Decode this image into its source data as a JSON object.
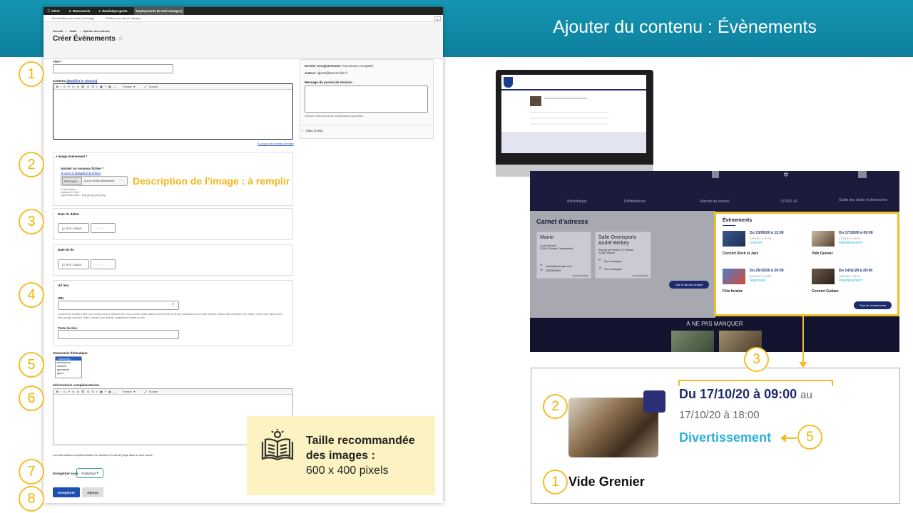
{
  "slide": {
    "title": "Ajouter du contenu : Évènements"
  },
  "toolbar": {
    "gerer": "Gérer",
    "raccourcis": "Raccourcis",
    "user": "dominique grota",
    "deploy": "Deployments (9 total changes)"
  },
  "subbar": {
    "preview": "Prévisualiser mon site (9 change)",
    "publish": "Publier mon site (9 change)"
  },
  "breadcrumb": [
    "Accueil",
    "Node",
    "Ajouter du contenu"
  ],
  "page_title": "Créer Événements",
  "form": {
    "titre_label": "Titre *",
    "contenu_label": "Contenu",
    "contenu_link": "(Modifier le résumé)",
    "format_label": "Format",
    "source_label": "Source",
    "formats_link": "À propos des formats de texte",
    "image_section": "Image événement *",
    "image_add": "Ajouter un nouveau fichier *",
    "image_browser": "Ouvrir le Navigateur de fichiers",
    "browse_button": "Parcourir...",
    "no_file": "Aucun fichier sélectionné.",
    "file_info": [
      "1 seul fichier.",
      "Limite à 10 Mo.",
      "Types autorisés : png gif jpg jpeg svg."
    ],
    "date_debut_label": "Date de début",
    "date_fin_label": "Date de fin",
    "date_placeholder": "jj / mm / aaaa",
    "time_placeholder": "--:--:--",
    "url_lieu_label": "Url lieu",
    "url_label": "URL",
    "url_help": "Commencer à saisir le titre d'un contenu pour le sélectionner. Vous pouvez aussi saisir le chemin interne tel que /node/add ou une URL externe comme http://example.com. Saisir <front> pour faire un lien vers la page d'accueil. Saisir <nolink> pour afficher uniquement le texte du lien.",
    "link_text_label": "Texte du lien",
    "taxonomy_label": "Taxonomie thématique",
    "taxonomy_options": [
      "- Aucun(e) -",
      "ceremonie",
      "concert",
      "spectacle",
      "sport"
    ],
    "info_label": "Informations complémentaires",
    "info_help": "Les informations complémentaires se situeront en bas de page dans un bloc coloré.",
    "save_as_label": "Enregistrer sous",
    "save_as_value": "Published",
    "save_button": "Enregistrer",
    "preview_button": "Aperçu"
  },
  "sidebar": {
    "last_saved_label": "Dernier enregistrement:",
    "last_saved_value": "Pas encore enregistré",
    "author_label": "Auteur:",
    "author_value": "dgrota@ternum-bfc.fr",
    "revision_label": "Message du journal de révision",
    "revision_help": "Décrivez brièvement les modifications apportées.",
    "url_alias": "Alias d'URL"
  },
  "annotations": {
    "image_desc": "Description de l'image : à remplir",
    "tip_line1": "Taille recommandée",
    "tip_line2": "des images :",
    "tip_line3": "600 x 400 pixels",
    "numbers": [
      "1",
      "2",
      "3",
      "4",
      "5",
      "6",
      "7",
      "8"
    ],
    "zoom_numbers": [
      "1",
      "2",
      "3",
      "5"
    ]
  },
  "site": {
    "nav": [
      "Bibliothèque",
      "Défibrillateurs",
      "Marché du samedi",
      "COVID-19",
      "Guide des droits et démarches"
    ],
    "carnet_title": "Carnet d'adresse",
    "cards": [
      {
        "title": "Mairie",
        "lines": [
          "2 rue Souvert",
          "21200 Gurnay Chardonville"
        ],
        "email": "mairie@exemple.com",
        "phone": "0352654983",
        "plan": "PLAN D'ACCÈS"
      },
      {
        "title": "Salle Omnisports André Berbey",
        "lines": [
          "Rue de la Perche À T'Olveau",
          "21250 Seurre"
        ],
        "email": "Non renseigné",
        "phone": "Non renseigné",
        "plan": "PLAN D'ACCÈS"
      }
    ],
    "carnet_button": "Voir le carnet complet",
    "events_title": "Événements",
    "events": [
      {
        "date": "Du 13/05/20 à 12:00",
        "au": "au",
        "date2": "13/05/20 à 20:00",
        "cat": "Concert",
        "name": "Concert Rock et Jazz"
      },
      {
        "date": "Du 17/10/20 à 09:00",
        "au": "au",
        "date2": "17/10/20 à 18:00",
        "cat": "Divertissement",
        "name": "Vide Grenier"
      },
      {
        "date": "Du 25/10/20 à 20:00",
        "au": "au",
        "date2": "25/10/20 à 23:00",
        "cat": "Spectacle",
        "name": "Fête foraine"
      },
      {
        "date": "Du 14/11/20 à 20:00",
        "au": "au",
        "date2": "14/11/20 à 23:00",
        "cat": "Divertissement",
        "name": "Concert Guitare"
      }
    ],
    "events_button": "Tous les événements",
    "manquer_title": "À NE PAS MANQUER"
  },
  "zoom": {
    "date": "Du 17/10/20 à 09:00",
    "au": "au",
    "date2": "17/10/20 à 18:00",
    "cat": "Divertissement",
    "name": "Vide Grenier"
  }
}
